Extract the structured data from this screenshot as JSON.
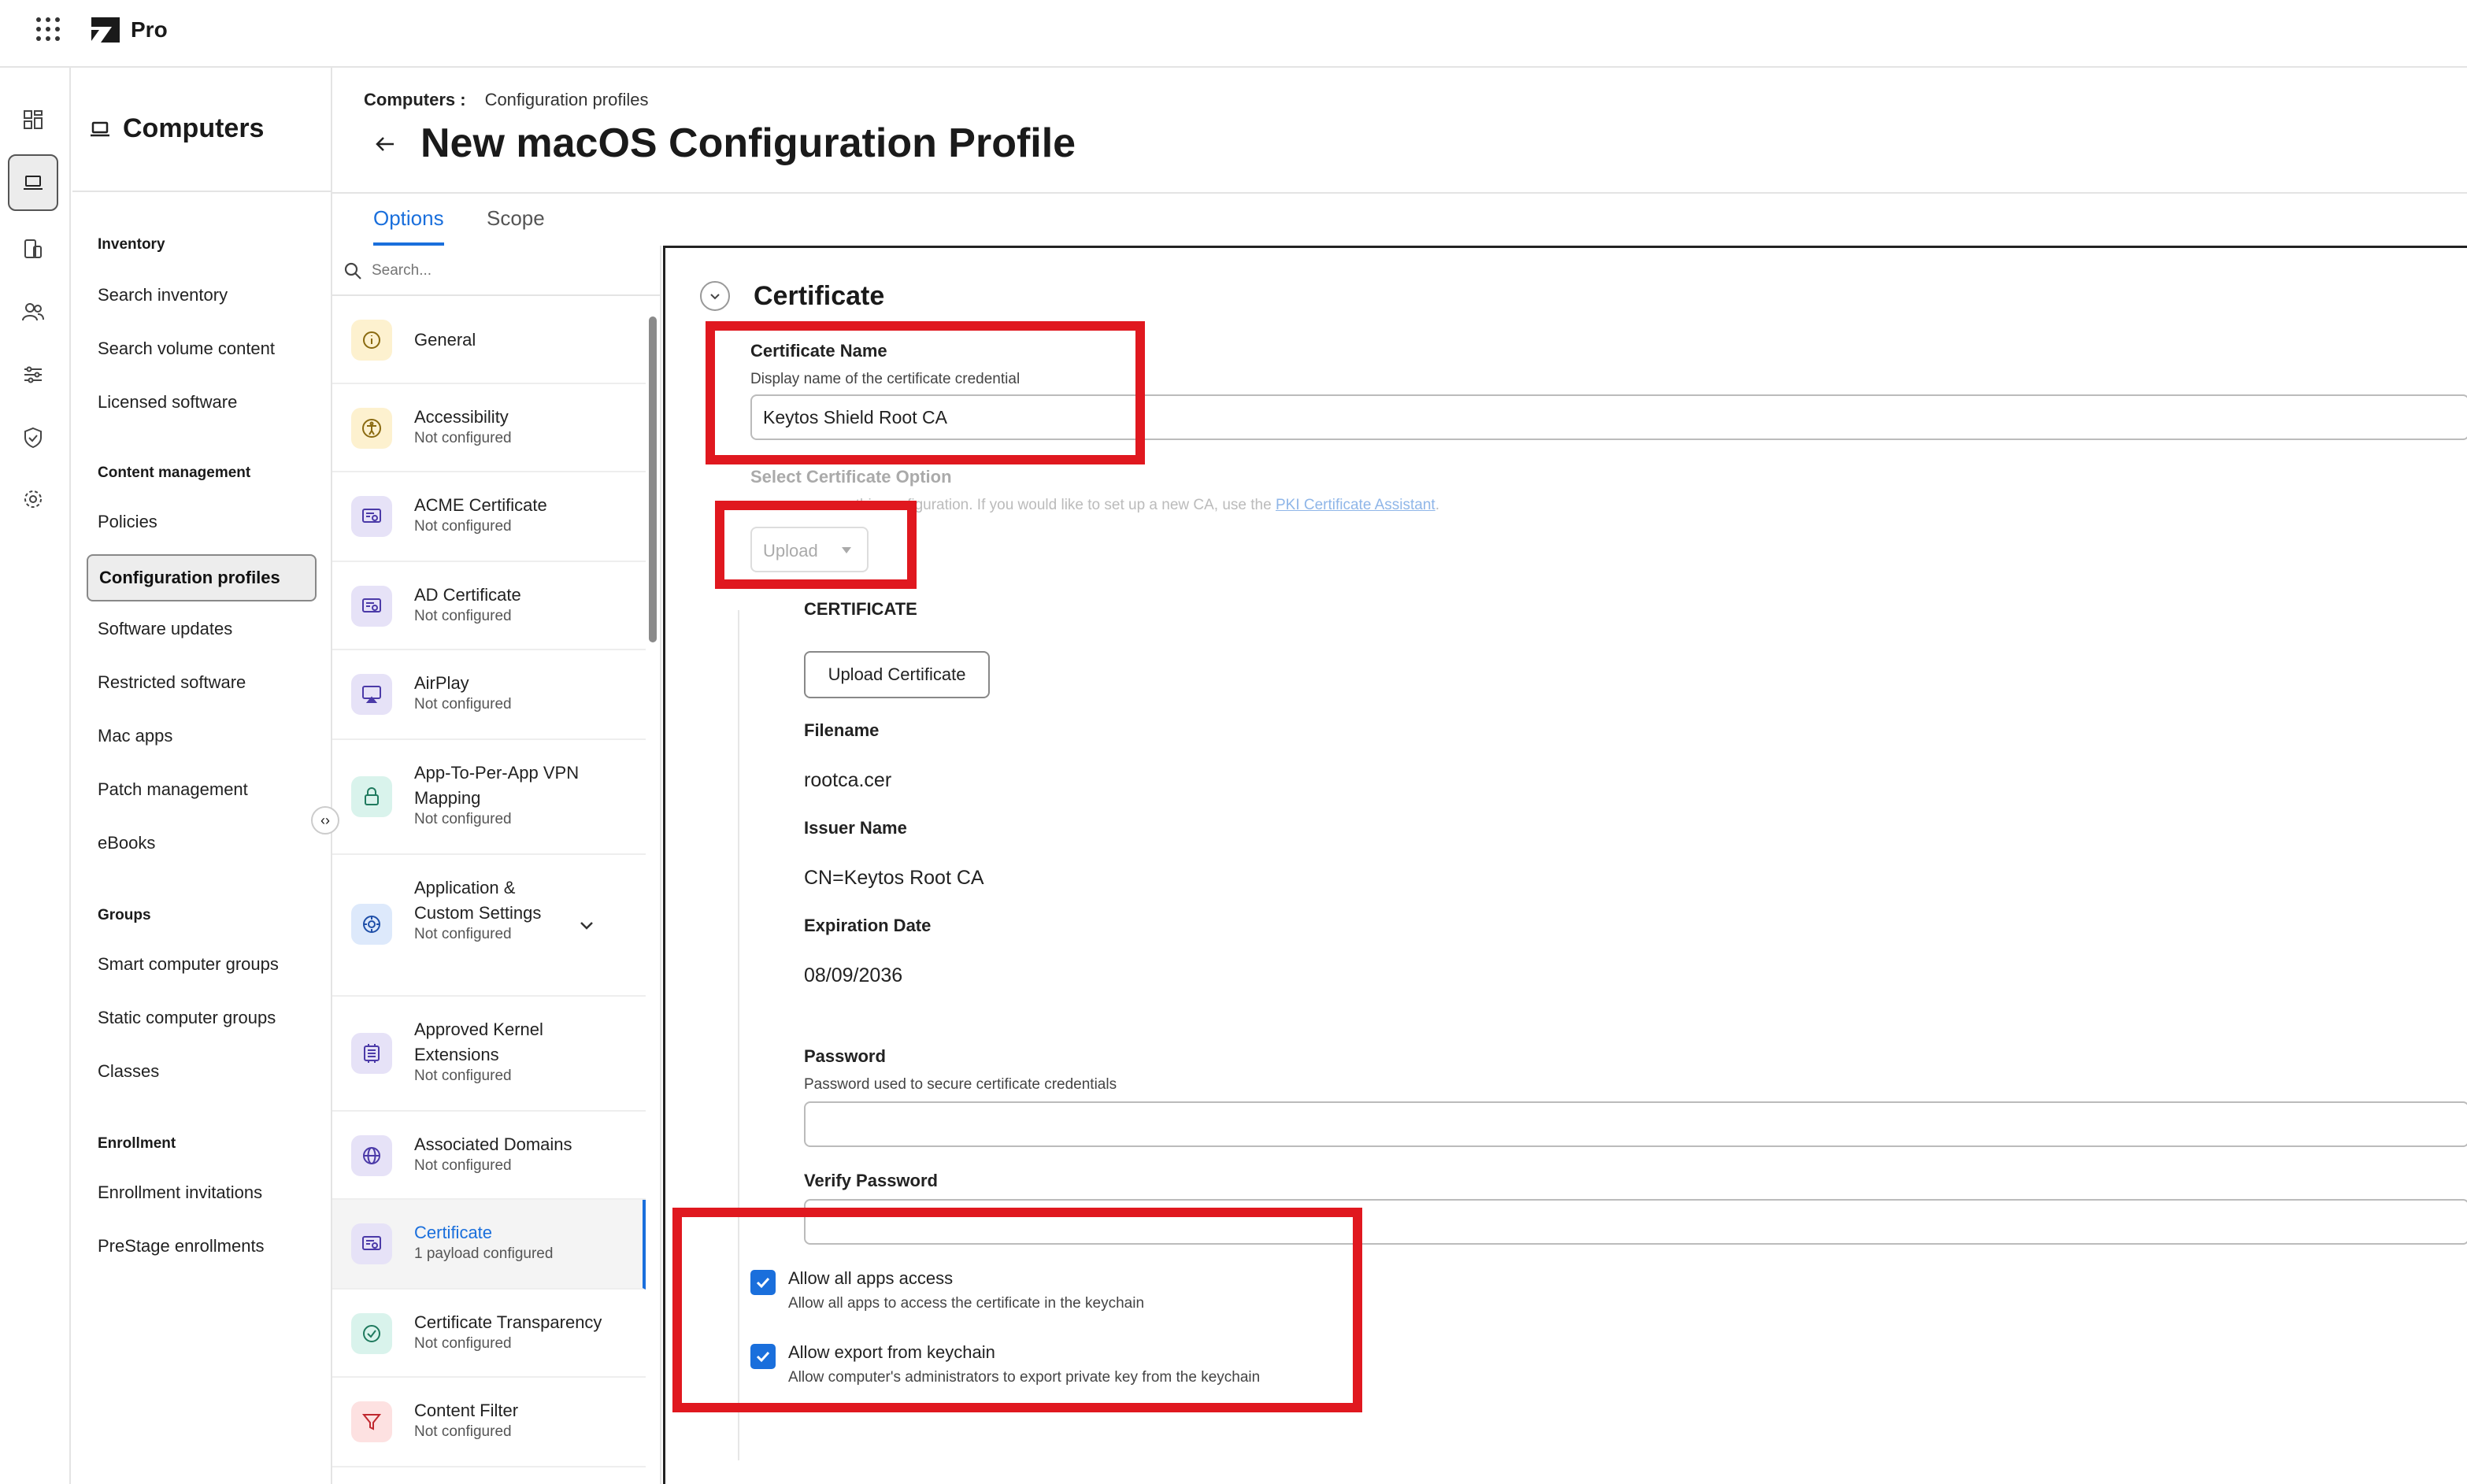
{
  "app": {
    "product": "Pro"
  },
  "nav": {
    "title": "Computers",
    "sections": [
      {
        "label": "Inventory",
        "links": [
          "Search inventory",
          "Search volume content",
          "Licensed software"
        ]
      },
      {
        "label": "Content management",
        "links": [
          "Policies",
          "Configuration profiles",
          "Software updates",
          "Restricted software",
          "Mac apps",
          "Patch management",
          "eBooks"
        ]
      },
      {
        "label": "Groups",
        "links": [
          "Smart computer groups",
          "Static computer groups",
          "Classes"
        ]
      },
      {
        "label": "Enrollment",
        "links": [
          "Enrollment invitations",
          "PreStage enrollments"
        ]
      }
    ],
    "active_link": "Configuration profiles"
  },
  "header": {
    "breadcrumb_root": "Computers :",
    "breadcrumb_current": "Configuration profiles",
    "title": "New macOS Configuration Profile",
    "tabs": [
      "Options",
      "Scope"
    ],
    "active_tab": "Options"
  },
  "payloads": {
    "search_placeholder": "Search...",
    "items": [
      {
        "name": "General",
        "status": "",
        "icon": "info-icon"
      },
      {
        "name": "Accessibility",
        "status": "Not configured",
        "icon": "accessibility-icon"
      },
      {
        "name": "ACME Certificate",
        "status": "Not configured",
        "icon": "certificate-icon"
      },
      {
        "name": "AD Certificate",
        "status": "Not configured",
        "icon": "certificate-icon"
      },
      {
        "name": "AirPlay",
        "status": "Not configured",
        "icon": "airplay-icon"
      },
      {
        "name": "App-To-Per-App VPN Mapping",
        "status": "Not configured",
        "icon": "lock-icon"
      },
      {
        "name": "Application & Custom Settings",
        "status": "Not configured",
        "icon": "settings-icon"
      },
      {
        "name": "Approved Kernel Extensions",
        "status": "Not configured",
        "icon": "kernel-icon"
      },
      {
        "name": "Associated Domains",
        "status": "Not configured",
        "icon": "globe-icon"
      },
      {
        "name": "Certificate",
        "status": "1 payload configured",
        "icon": "certificate-icon"
      },
      {
        "name": "Certificate Transparency",
        "status": "Not configured",
        "icon": "check-circle-icon"
      },
      {
        "name": "Content Filter",
        "status": "Not configured",
        "icon": "filter-icon"
      }
    ],
    "active": "Certificate"
  },
  "certificate": {
    "section_title": "Certificate",
    "name_label": "Certificate Name",
    "name_help": "Display name of the certificate credential",
    "name_value": "Keytos Shield Root CA",
    "option_label": "Select Certificate Option",
    "option_help_prefix": "r this configuration. If you would like to set up a new CA, use the",
    "option_help_link": "PKI Certificate Assistant",
    "option_help_suffix": ".",
    "option_value": "Upload",
    "cert_heading": "CERTIFICATE",
    "upload_button": "Upload Certificate",
    "filename_label": "Filename",
    "filename_value": "rootca.cer",
    "issuer_label": "Issuer Name",
    "issuer_value": "CN=Keytos Root CA",
    "expiration_label": "Expiration Date",
    "expiration_value": "08/09/2036",
    "password_label": "Password",
    "password_help": "Password used to secure certificate credentials",
    "password_value": "",
    "verify_label": "Verify Password",
    "verify_value": "",
    "allow_all_label": "Allow all apps access",
    "allow_all_help": "Allow all apps to access the certificate in the keychain",
    "allow_all_checked": true,
    "allow_export_label": "Allow export from keychain",
    "allow_export_help": "Allow computer's administrators to export private key from the keychain",
    "allow_export_checked": true
  },
  "colors": {
    "accent": "#1a6fdc",
    "highlight": "#e0181f"
  }
}
